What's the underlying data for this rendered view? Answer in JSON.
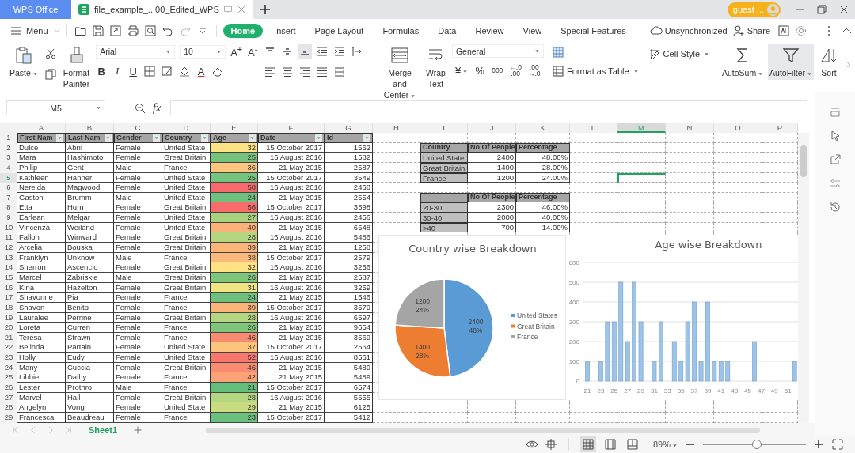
{
  "app_tab": {
    "label": "WPS Office"
  },
  "doc_tab": {
    "label": "file_example_...00_Edited_WPS",
    "selected": true
  },
  "account": {
    "label": "guest ..."
  },
  "menu": {
    "label": "Menu"
  },
  "ribbon_tabs": [
    {
      "label": "Home",
      "selected": true
    },
    {
      "label": "Insert",
      "selected": false
    },
    {
      "label": "Page Layout",
      "selected": false
    },
    {
      "label": "Formulas",
      "selected": false
    },
    {
      "label": "Data",
      "selected": false
    },
    {
      "label": "Review",
      "selected": false
    },
    {
      "label": "View",
      "selected": false
    },
    {
      "label": "Special Features",
      "selected": false
    }
  ],
  "sync": {
    "label": "Unsynchronized"
  },
  "share": {
    "label": "Share"
  },
  "ribbon": {
    "paste": "Paste",
    "format_painter": "Format Painter",
    "font_name": "Arial",
    "font_size": "10",
    "glyphs": {
      "grow": "A$^{+}$",
      "shrink": "A$^{-}$",
      "bold": "B",
      "italic": "I",
      "underline": "U",
      "font_color": "A"
    },
    "vertical_align": [
      {
        "kind": "top",
        "selected": false
      },
      {
        "kind": "middle",
        "selected": false
      },
      {
        "kind": "bottom",
        "selected": true
      }
    ],
    "merge": "Merge and Center",
    "wrap": "Wrap Text",
    "number_format": "General",
    "currency": "¥",
    "percent": "%",
    "thousands": "000",
    "increase_decimal": [
      "←.0",
      ".00"
    ],
    "decrease_decimal": [
      ".00",
      "→.0"
    ],
    "format_table": "Format as Table",
    "cell_style": "Cell Style",
    "autosum": "AutoSum",
    "autofilter": {
      "label": "AutoFilter",
      "selected": true
    },
    "sort": "Sort"
  },
  "formula_bar": {
    "name_box": "M5",
    "fx": "fx"
  },
  "sheet": {
    "columns": [
      {
        "label": "A",
        "selected": false
      },
      {
        "label": "B",
        "selected": false
      },
      {
        "label": "C",
        "selected": false
      },
      {
        "label": "D",
        "selected": false
      },
      {
        "label": "E",
        "selected": false
      },
      {
        "label": "F",
        "selected": false
      },
      {
        "label": "G",
        "selected": false
      },
      {
        "label": "H",
        "selected": false
      },
      {
        "label": "I",
        "selected": false
      },
      {
        "label": "J",
        "selected": false
      },
      {
        "label": "K",
        "selected": false
      },
      {
        "label": "L",
        "selected": false
      },
      {
        "label": "M",
        "selected": true
      },
      {
        "label": "N",
        "selected": false
      },
      {
        "label": "O",
        "selected": false
      },
      {
        "label": "P",
        "selected": false
      }
    ],
    "row_numbers": [
      {
        "label": "1",
        "selected": false
      },
      {
        "label": "2",
        "selected": false
      },
      {
        "label": "3",
        "selected": false
      },
      {
        "label": "4",
        "selected": false
      },
      {
        "label": "5",
        "selected": true
      },
      {
        "label": "6",
        "selected": false
      },
      {
        "label": "7",
        "selected": false
      },
      {
        "label": "8",
        "selected": false
      },
      {
        "label": "9",
        "selected": false
      },
      {
        "label": "10",
        "selected": false
      },
      {
        "label": "11",
        "selected": false
      },
      {
        "label": "12",
        "selected": false
      },
      {
        "label": "13",
        "selected": false
      },
      {
        "label": "14",
        "selected": false
      },
      {
        "label": "15",
        "selected": false
      },
      {
        "label": "16",
        "selected": false
      },
      {
        "label": "17",
        "selected": false
      },
      {
        "label": "18",
        "selected": false
      },
      {
        "label": "19",
        "selected": false
      },
      {
        "label": "20",
        "selected": false
      },
      {
        "label": "21",
        "selected": false
      },
      {
        "label": "22",
        "selected": false
      },
      {
        "label": "23",
        "selected": false
      },
      {
        "label": "24",
        "selected": false
      },
      {
        "label": "25",
        "selected": false
      },
      {
        "label": "26",
        "selected": false
      },
      {
        "label": "27",
        "selected": false
      },
      {
        "label": "28",
        "selected": false
      },
      {
        "label": "29",
        "selected": false
      }
    ],
    "people_table": {
      "headers": [
        "First Nam",
        "Last Nam",
        "Gender",
        "Country",
        "Age",
        "Date",
        "Id"
      ],
      "rows": [
        {
          "cells": [
            "Dulce",
            "Abril",
            "Female",
            "United State",
            "32",
            "15 October 2017",
            "1562"
          ],
          "color": "#fee283"
        },
        {
          "cells": [
            "Mara",
            "Hashimoto",
            "Female",
            "Great Britain",
            "25",
            "16 August 2016",
            "1582"
          ],
          "color": "#76c37d"
        },
        {
          "cells": [
            "Philip",
            "Gent",
            "Male",
            "France",
            "36",
            "21 May 2015",
            "2587"
          ],
          "color": "#fdc57d"
        },
        {
          "cells": [
            "Kathleen",
            "Hanner",
            "Female",
            "United State",
            "25",
            "15 October 2017",
            "3549"
          ],
          "color": "#76c37d"
        },
        {
          "cells": [
            "Nereida",
            "Magwood",
            "Female",
            "United State",
            "58",
            "16 August 2016",
            "2468"
          ],
          "color": "#f8696b"
        },
        {
          "cells": [
            "Gaston",
            "Brumm",
            "Male",
            "United State",
            "24",
            "21 May 2015",
            "2554"
          ],
          "color": "#6dc17c"
        },
        {
          "cells": [
            "Etta",
            "Hurn",
            "Female",
            "Great Britain",
            "56",
            "15 October 2017",
            "3598"
          ],
          "color": "#f86c6b"
        },
        {
          "cells": [
            "Earlean",
            "Melgar",
            "Female",
            "United State",
            "27",
            "16 August 2016",
            "2456"
          ],
          "color": "#a9d27f"
        },
        {
          "cells": [
            "Vincenza",
            "Weiland",
            "Female",
            "United State",
            "40",
            "21 May 2015",
            "6548"
          ],
          "color": "#fcb179"
        },
        {
          "cells": [
            "Fallon",
            "Winward",
            "Female",
            "Great Britain",
            "28",
            "16 August 2016",
            "5486"
          ],
          "color": "#b5d680"
        },
        {
          "cells": [
            "Arcelia",
            "Bouska",
            "Female",
            "Great Britain",
            "39",
            "21 May 2015",
            "1258"
          ],
          "color": "#fcb579"
        },
        {
          "cells": [
            "Franklyn",
            "Unknow",
            "Male",
            "France",
            "38",
            "15 October 2017",
            "2579"
          ],
          "color": "#fcb87a"
        },
        {
          "cells": [
            "Sherron",
            "Ascencio",
            "Female",
            "Great Britain",
            "32",
            "16 August 2016",
            "3256"
          ],
          "color": "#fee283"
        },
        {
          "cells": [
            "Marcel",
            "Zabriskie",
            "Male",
            "Great Britain",
            "26",
            "21 May 2015",
            "2587"
          ],
          "color": "#7fc67d"
        },
        {
          "cells": [
            "Kina",
            "Hazelton",
            "Female",
            "Great Britain",
            "31",
            "16 August 2016",
            "3259"
          ],
          "color": "#f0e483"
        },
        {
          "cells": [
            "Shavonne",
            "Pia",
            "Female",
            "France",
            "24",
            "21 May 2015",
            "1546"
          ],
          "color": "#6dc17c"
        },
        {
          "cells": [
            "Shavon",
            "Benito",
            "Female",
            "France",
            "39",
            "15 October 2017",
            "3579"
          ],
          "color": "#fcb579"
        },
        {
          "cells": [
            "Lauralee",
            "Perrine",
            "Female",
            "Great Britain",
            "28",
            "16 August 2016",
            "6597"
          ],
          "color": "#b5d680"
        },
        {
          "cells": [
            "Loreta",
            "Curren",
            "Female",
            "France",
            "26",
            "21 May 2015",
            "9654"
          ],
          "color": "#7fc67d"
        },
        {
          "cells": [
            "Teresa",
            "Strawn",
            "Female",
            "France",
            "46",
            "21 May 2015",
            "3569"
          ],
          "color": "#f98b71"
        },
        {
          "cells": [
            "Belinda",
            "Partain",
            "Female",
            "United State",
            "37",
            "15 October 2017",
            "2564"
          ],
          "color": "#fdc47c"
        },
        {
          "cells": [
            "Holly",
            "Eudy",
            "Female",
            "United State",
            "52",
            "16 August 2016",
            "8561"
          ],
          "color": "#f8766d"
        },
        {
          "cells": [
            "Many",
            "Cuccia",
            "Female",
            "Great Britain",
            "46",
            "21 May 2015",
            "5489"
          ],
          "color": "#f98b71"
        },
        {
          "cells": [
            "Libbie",
            "Dalby",
            "Female",
            "France",
            "42",
            "21 May 2015",
            "5489"
          ],
          "color": "#fba276"
        },
        {
          "cells": [
            "Lester",
            "Prothro",
            "Male",
            "France",
            "21",
            "15 October 2017",
            "6574"
          ],
          "color": "#63be7b"
        },
        {
          "cells": [
            "Marvel",
            "Hail",
            "Female",
            "Great Britain",
            "28",
            "16 August 2016",
            "5555"
          ],
          "color": "#b5d680"
        },
        {
          "cells": [
            "Angelyn",
            "Vong",
            "Female",
            "United State",
            "29",
            "21 May 2015",
            "6125"
          ],
          "color": "#cadc81"
        },
        {
          "cells": [
            "Francesca",
            "Beaudreau",
            "Female",
            "France",
            "23",
            "15 October 2017",
            "5412"
          ],
          "color": "#6ac07c"
        }
      ]
    },
    "country_summary": {
      "label_header": "Country",
      "headers": [
        "No Of People",
        "Percentage"
      ],
      "rows": [
        [
          "United State",
          "2400",
          "48.00%"
        ],
        [
          "Great Britain",
          "1400",
          "28.00%"
        ],
        [
          "France",
          "1200",
          "24.00%"
        ]
      ]
    },
    "age_summary": {
      "headers": [
        "No Of People",
        "Percentage"
      ],
      "rows": [
        [
          "20-30",
          "2300",
          "46.00%"
        ],
        [
          "30-40",
          "2000",
          "40.00%"
        ],
        [
          ">40",
          "700",
          "14.00%"
        ]
      ]
    }
  },
  "pie_chart": {
    "chart_data": {
      "type": "pie",
      "title": "Country wise Breakdown",
      "legend": "right",
      "categories": [
        "United States",
        "Great Britain",
        "France"
      ],
      "values": [
        48,
        28,
        24
      ],
      "colors": [
        "#5b9bd5",
        "#ed7d31",
        "#a5a5a5"
      ],
      "value_labels": [
        [
          "2400",
          "48%"
        ],
        [
          "1400",
          "28%"
        ],
        [
          "1200",
          "24%"
        ]
      ]
    }
  },
  "bar_chart": {
    "chart_data": {
      "type": "bar",
      "title": "Age wise Breakdown",
      "grid": true,
      "x": [
        21,
        23,
        24,
        25,
        26,
        27,
        28,
        29,
        31,
        32,
        34,
        35,
        36,
        37,
        38,
        39,
        40,
        41,
        42,
        46,
        52
      ],
      "values": [
        100,
        100,
        300,
        300,
        500,
        200,
        500,
        300,
        100,
        300,
        200,
        100,
        300,
        400,
        100,
        400,
        100,
        100,
        100,
        200,
        100
      ],
      "xticks": [
        21,
        23,
        25,
        27,
        29,
        31,
        33,
        35,
        37,
        39,
        41,
        43,
        45,
        47,
        49,
        51
      ],
      "xlim": [
        20.4,
        52.4
      ],
      "ylim": [
        0,
        600
      ],
      "yticks": [
        0,
        100,
        200,
        300,
        400,
        500,
        600
      ]
    }
  },
  "sheet_tabs": [
    {
      "label": "Sheet1",
      "selected": true
    }
  ],
  "status_bar": {
    "views": [
      {
        "kind": "normal",
        "selected": true
      },
      {
        "kind": "page",
        "selected": false
      },
      {
        "kind": "break",
        "selected": false
      }
    ],
    "zoom": "89%",
    "zoom_slider": {
      "level": 0.52
    }
  }
}
